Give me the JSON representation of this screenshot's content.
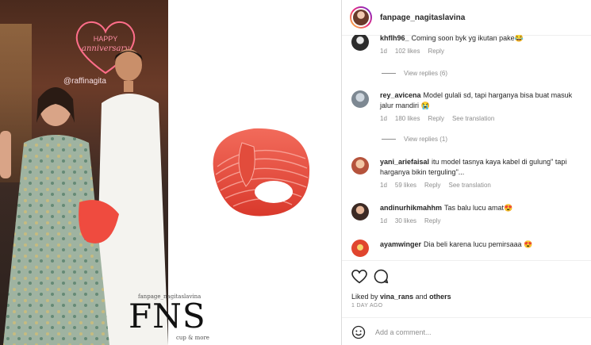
{
  "post": {
    "photo_tag": "@raffinagita",
    "neon_line1": "HAPPY",
    "neon_line2": "anniversary",
    "watermark_small": "fanpage_nagitaslavina",
    "watermark_big": "FNS",
    "watermark_sub": "cup & more"
  },
  "header": {
    "username": "fanpage_nagitaslavina"
  },
  "comments": [
    {
      "user": "khflh96_",
      "text": "Coming soon byk yg ikutan pake😂",
      "age": "1d",
      "likes": "102 likes",
      "reply": "Reply",
      "translate": ""
    },
    {
      "user": "rey_avicena",
      "text": "Model gulali sd, tapi harganya bisa buat masuk jalur mandiri 😭",
      "age": "1d",
      "likes": "180 likes",
      "reply": "Reply",
      "translate": "See translation"
    },
    {
      "user": "yani_ariefaisal",
      "text": "itu model tasnya kaya kabel di gulung\" tapi harganya bikin terguling\"...",
      "age": "1d",
      "likes": "59 likes",
      "reply": "Reply",
      "translate": "See translation"
    },
    {
      "user": "andinurhikmahhm",
      "text": "Tas balu lucu amat😍",
      "age": "1d",
      "likes": "30 likes",
      "reply": "Reply",
      "translate": ""
    },
    {
      "user": "ayamwinger",
      "text": "Dia beli karena lucu pemirsaaa 😍",
      "age": "",
      "likes": "",
      "reply": "",
      "translate": ""
    }
  ],
  "view_replies": [
    "View replies (6)",
    "View replies (1)"
  ],
  "likes_line": {
    "prefix": "Liked by",
    "user": "vina_rans",
    "middle": "and",
    "others": "others"
  },
  "time_ago": "1 DAY AGO",
  "add_comment_placeholder": "Add a comment..."
}
